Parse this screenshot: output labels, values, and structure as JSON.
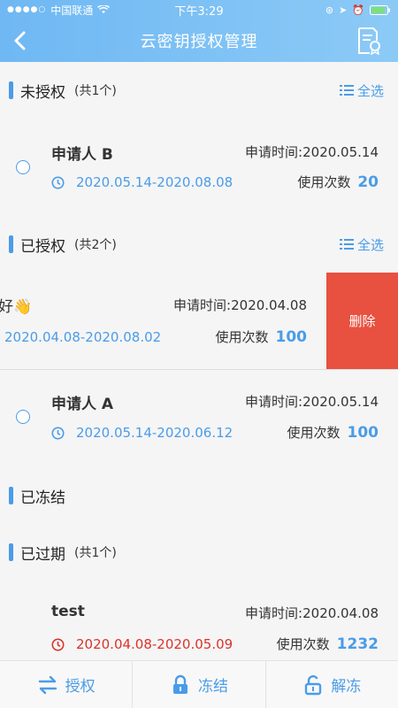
{
  "status": {
    "carrier": "中国联通",
    "time": "下午3:29"
  },
  "header": {
    "title": "云密钥授权管理"
  },
  "sections": {
    "unauthorized": {
      "title": "未授权",
      "count": "(共1个)",
      "select_all": "全选"
    },
    "authorized": {
      "title": "已授权",
      "count": "(共2个)",
      "select_all": "全选"
    },
    "frozen": {
      "title": "已冻结"
    },
    "expired": {
      "title": "已过期",
      "count": "(共1个)"
    }
  },
  "cards": [
    {
      "name": "申请人 B",
      "apply": "申请时间:2020.05.14",
      "range": "2020.05.14-2020.08.08",
      "uses_label": "使用次数",
      "uses": "20"
    },
    {
      "name": "好👋",
      "apply": "申请时间:2020.04.08",
      "range": "2020.04.08-2020.08.02",
      "uses_label": "使用次数",
      "uses": "100"
    },
    {
      "name": "申请人 A",
      "apply": "申请时间:2020.05.14",
      "range": "2020.05.14-2020.06.12",
      "uses_label": "使用次数",
      "uses": "100"
    },
    {
      "name": "test",
      "apply": "申请时间:2020.04.08",
      "range": "2020.04.08-2020.05.09",
      "uses_label": "使用次数",
      "uses": "1232"
    }
  ],
  "delete_label": "删除",
  "toolbar": {
    "authorize": "授权",
    "freeze": "冻结",
    "unfreeze": "解冻"
  },
  "colors": {
    "accent": "#4a9ce8",
    "delete": "#e85040",
    "expired": "#d9342b"
  }
}
